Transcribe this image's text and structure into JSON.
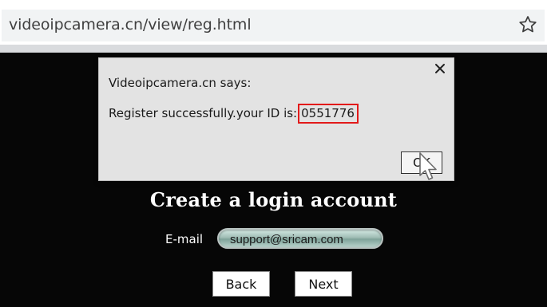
{
  "browser": {
    "url": "videoipcamera.cn/view/reg.html",
    "bookmark_icon": "star-outline-icon"
  },
  "page": {
    "title": "Create a login account",
    "email_label": "E-mail",
    "email_value": "support@sricam.com",
    "back_label": "Back",
    "next_label": "Next",
    "background_color": "#060606"
  },
  "dialog": {
    "title": "Videoipcamera.cn says:",
    "message_prefix": "Register successfully.your ID is:",
    "id_value": "0551776",
    "ok_label": "OK",
    "close_icon": "close-icon",
    "highlight_color": "#e21a1a"
  },
  "cursor": {
    "icon": "arrow-cursor-icon"
  }
}
